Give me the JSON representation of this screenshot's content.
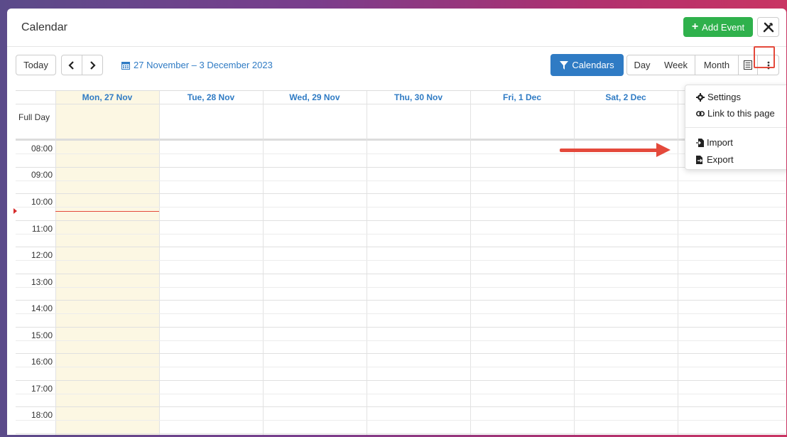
{
  "header": {
    "title": "Calendar",
    "add_event_label": "Add Event"
  },
  "toolbar": {
    "today_label": "Today",
    "date_range": "27 November – 3 December 2023",
    "calendars_label": "Calendars",
    "views": {
      "day": "Day",
      "week": "Week",
      "month": "Month"
    }
  },
  "grid": {
    "days": [
      "Mon, 27 Nov",
      "Tue, 28 Nov",
      "Wed, 29 Nov",
      "Thu, 30 Nov",
      "Fri, 1 Dec",
      "Sat, 2 Dec"
    ],
    "full_day_label": "Full Day",
    "times": [
      "08:00",
      "09:00",
      "10:00",
      "11:00",
      "12:00",
      "13:00",
      "14:00",
      "15:00",
      "16:00",
      "17:00",
      "18:00"
    ]
  },
  "menu": {
    "settings": "Settings",
    "link": "Link to this page",
    "import": "Import",
    "export": "Export"
  },
  "colors": {
    "accent": "#2f7bc4",
    "add": "#2fb14c",
    "annotation": "#e4493b",
    "today_bg": "#fcf7e3"
  }
}
